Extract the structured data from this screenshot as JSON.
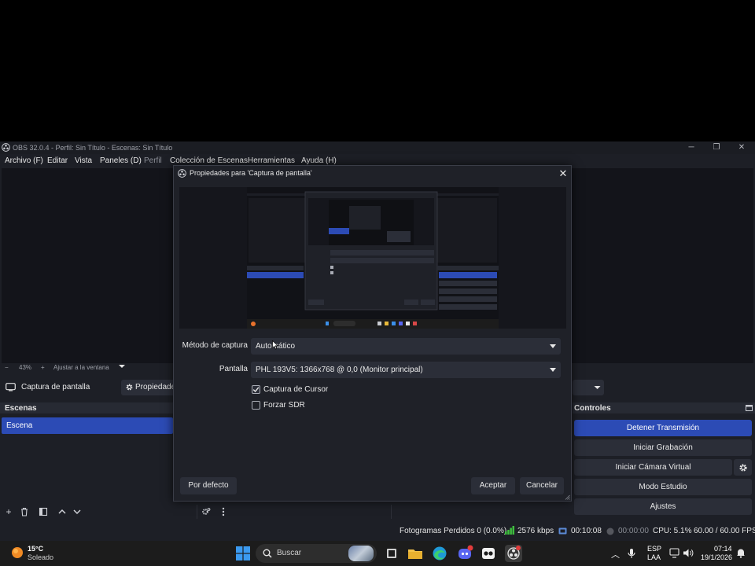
{
  "app": {
    "title": "OBS 32.0.4 - Perfil: Sin Título - Escenas: Sin Título",
    "menu": [
      "Archivo (F)",
      "Editar",
      "Vista",
      "Paneles (D)",
      "Perfil",
      "Colección de Escenas",
      "Herramientas",
      "Ayuda (H)"
    ]
  },
  "zoom_bar": {
    "zoom": "43%",
    "fit_label": "Ajustar a la ventana"
  },
  "source_bar": {
    "source_name": "Captura de pantalla",
    "properties_label": "Propiedade"
  },
  "scenes": {
    "header": "Escenas",
    "items": [
      "Escena"
    ]
  },
  "controls": {
    "header": "Controles",
    "buttons": [
      "Detener Transmisión",
      "Iniciar Grabación",
      "Iniciar Cámara Virtual",
      "Modo Estudio",
      "Ajustes"
    ]
  },
  "status": {
    "dropped_frames": "Fotogramas Perdidos 0 (0.0%)",
    "bitrate": "2576 kbps",
    "stream_time": "00:10:08",
    "record_time": "00:00:00",
    "cpu": "CPU: 5.1%",
    "fps": "60.00 / 60.00 FPS"
  },
  "dialog": {
    "title": "Propiedades para 'Captura de pantalla'",
    "capture_method_label": "Método de captura",
    "capture_method_value": "Automático",
    "display_label": "Pantalla",
    "display_value": "PHL 193V5: 1366x768 @ 0,0 (Monitor principal)",
    "capture_cursor_label": "Captura de Cursor",
    "capture_cursor_checked": true,
    "force_sdr_label": "Forzar SDR",
    "force_sdr_checked": false,
    "defaults_button": "Por defecto",
    "ok_button": "Aceptar",
    "cancel_button": "Cancelar"
  },
  "taskbar": {
    "weather_temp": "15°C",
    "weather_desc": "Soleado",
    "search_placeholder": "Buscar",
    "language": "ESP",
    "layout": "LAA",
    "time": "07:14",
    "date": "19/1/2026"
  },
  "colors": {
    "accent": "#2c4bb5",
    "window_bg": "#1d1f26",
    "panel_button": "#2b2e38",
    "bitrate_indicator": "#3fbf3f"
  }
}
